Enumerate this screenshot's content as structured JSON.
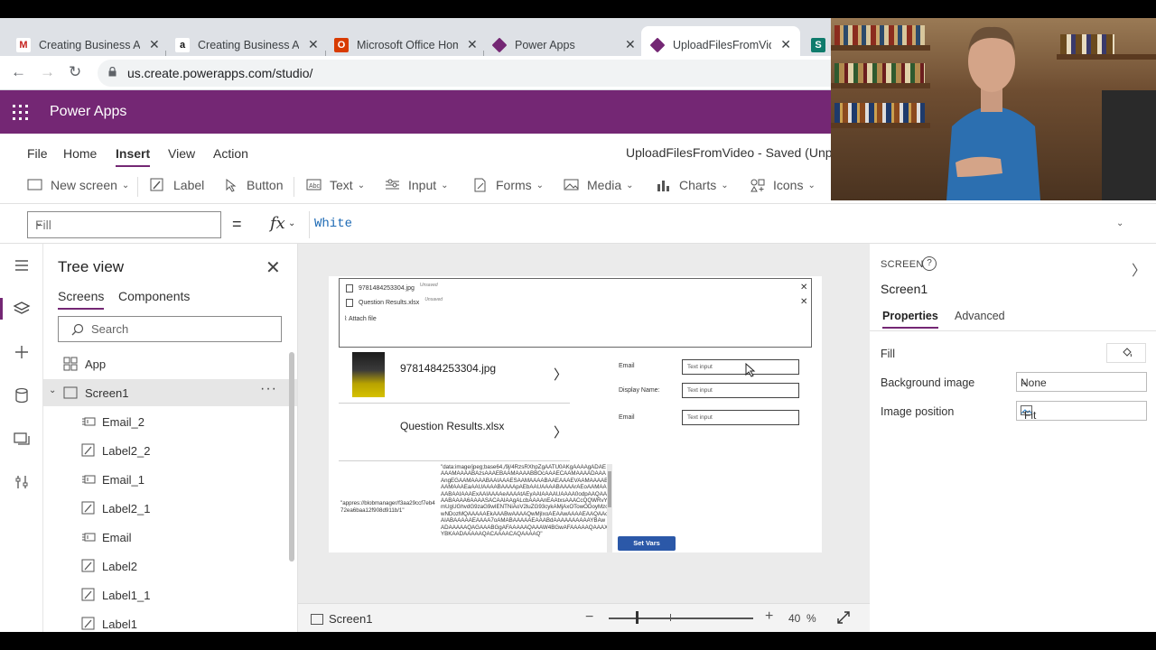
{
  "browser": {
    "tabs": [
      {
        "title": "Creating Business Ap",
        "icon": "gmail-icon"
      },
      {
        "title": "Creating Business Ap",
        "icon": "amazon-icon"
      },
      {
        "title": "Microsoft Office Hom",
        "icon": "office-icon"
      },
      {
        "title": "Power Apps",
        "icon": "powerapps-icon"
      },
      {
        "title": "UploadFilesFromVide",
        "icon": "powerapps-icon"
      }
    ],
    "url": "us.create.powerapps.com/studio/"
  },
  "app": {
    "name": "Power Apps",
    "menu": [
      "File",
      "Home",
      "Insert",
      "View",
      "Action"
    ],
    "selected_menu": "Insert",
    "saved_status": "UploadFilesFromVideo - Saved (Unpublished)"
  },
  "ribbon": {
    "new_screen": "New screen",
    "label": "Label",
    "button": "Button",
    "text": "Text",
    "input": "Input",
    "forms": "Forms",
    "media": "Media",
    "charts": "Charts",
    "icons": "Icons"
  },
  "formula": {
    "property": "Fill",
    "equals": "=",
    "fx": "fx",
    "value": "White"
  },
  "tree": {
    "title": "Tree view",
    "tabs": [
      "Screens",
      "Components"
    ],
    "search_placeholder": "Search",
    "app_label": "App",
    "screen_label": "Screen1",
    "items": [
      "Email_2",
      "Label2_2",
      "Email_1",
      "Label2_1",
      "Email",
      "Label2",
      "Label1_1",
      "Label1"
    ]
  },
  "canvas": {
    "attachments": [
      {
        "name": "9781484253304.jpg",
        "status": "Unsaved"
      },
      {
        "name": "Question Results.xlsx",
        "status": "Unsaved"
      }
    ],
    "attach_file": "Attach file",
    "gallery": [
      "9781484253304.jpg",
      "Question Results.xlsx"
    ],
    "form_labels": [
      "Email",
      "Display Name:",
      "Email"
    ],
    "input_placeholder": "Text input",
    "appres_text": "\"appres://blobmanager/f3aa29ccf7eb472ea6baa12f908d911b/1\"",
    "base64_text": "\"data:image/jpeg;base64,/9j/4RzsRXhpZgAATU0AKgAAAAgADAEAAAMAAAABAzsAAAEBAAMAAAABBOcAAAECAAMAAAADAAAAngEGAAMAAAABAAIAAAESAAMAAAABAAEAAAEVAAMAAAABAAMAAAEaAAUAAAABAAAApAEbAAUAAAABAAAArAEoAAMAAAABAAIAAAExAAIAAAAeAAAAtAEyAAIAAAAUAAAA0odpAAQAAAABAAAA6AAAASACAAIAAgALcbAAAAnEAAtxsAAACcQQWRvYmUgUGhvdG9zaG9wIENTNiAoV2luZG93cykAMjAxOTowODoyMzowNDozMQAAAAAEkAAABwAAAAQwMjIxoAEAAwAAAAEAAQAAoAIABAAAAAEAAAA7oAMABAAAAAEAAABdAAAAAAAAAAYBAwADAAAAAQAGAAABGgAFAAAAAQAAAW4BGwAFAAAAAQAAAXYBKAADAAAAAQACAAAACAQAAAAQ\"",
    "set_vars": "Set Vars",
    "footer_screen": "Screen1",
    "zoom_value": "40",
    "zoom_unit": "%"
  },
  "properties": {
    "kind": "SCREEN",
    "name": "Screen1",
    "tabs": [
      "Properties",
      "Advanced"
    ],
    "fill_label": "Fill",
    "fill_color": "#ffffff",
    "background_image_label": "Background image",
    "background_image_value": "None",
    "image_position_label": "Image position",
    "image_position_value": "Fit"
  },
  "colors": {
    "brand": "#742774",
    "set_vars": "#2b58a8"
  }
}
